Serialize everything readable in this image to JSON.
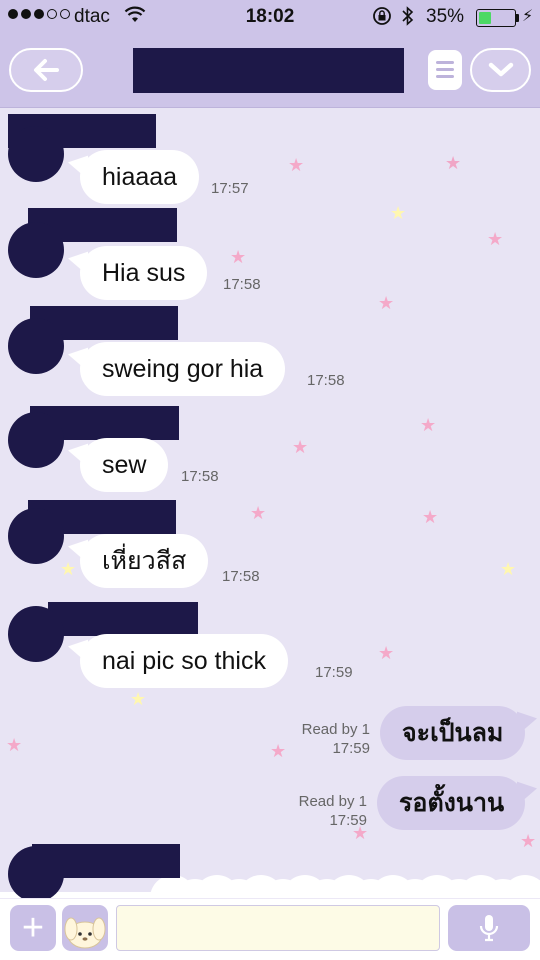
{
  "status_bar": {
    "carrier": "dtac",
    "signal_bars_filled": 3,
    "signal_bars_total": 5,
    "time": "18:02",
    "battery_percent": "35%",
    "battery_level": 0.35
  },
  "nav": {
    "back_icon": "back-arrow-icon",
    "menu_icon": "menu-list-icon",
    "down_icon": "chevron-down-icon"
  },
  "messages": [
    {
      "side": "in",
      "text": "hiaaaa",
      "time": "17:57"
    },
    {
      "side": "in",
      "text": "Hia sus",
      "time": "17:58"
    },
    {
      "side": "in",
      "text": "sweing gor hia",
      "time": "17:58"
    },
    {
      "side": "in",
      "text": "sew",
      "time": "17:58"
    },
    {
      "side": "in",
      "text": "เหี่ยวสีส",
      "time": "17:58"
    },
    {
      "side": "in",
      "text": "nai pic so thick",
      "time": "17:59"
    },
    {
      "side": "out",
      "text": "จะเป็นลม",
      "read": "Read by 1",
      "time": "17:59"
    },
    {
      "side": "out",
      "text": "รอตั้งนาน",
      "read": "Read by 1",
      "time": "17:59"
    }
  ],
  "input": {
    "plus_icon": "plus-icon",
    "sticker_icon": "sticker-icon",
    "mic_icon": "microphone-icon",
    "placeholder": ""
  },
  "colors": {
    "header": "#cdc4e8",
    "chat_bg": "#e8e4f4",
    "outgoing_bubble": "#d5cdeb",
    "redaction": "#1d1848",
    "battery": "#4cd964"
  }
}
